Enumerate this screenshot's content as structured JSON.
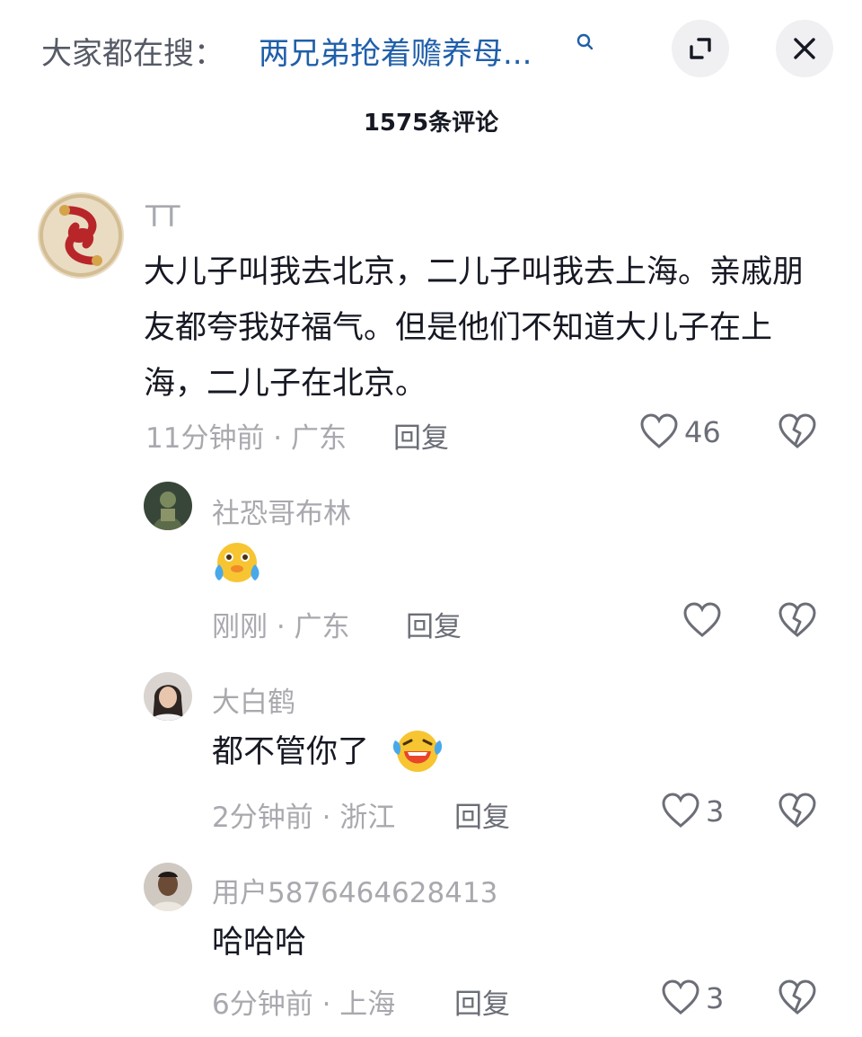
{
  "header": {
    "search_prefix": "大家都在搜：",
    "search_query": "两兄弟抢着赡养母...",
    "search_icon": "search-icon",
    "expand_icon": "expand-icon",
    "close_icon": "close-icon"
  },
  "comment_count": "1575条评论",
  "comments": [
    {
      "username": "TT",
      "text": "大儿子叫我去北京，二儿子叫我去上海。亲戚朋友都夸我好福气。但是他们不知道大儿子在上海，二儿子在北京。",
      "time": "11分钟前 · 广东",
      "reply_label": "回复",
      "likes": "46",
      "avatar_icon": "pisces-avatar"
    },
    {
      "username": "社恐哥布林",
      "text": "",
      "emoji": "crying-laughing-emoji",
      "time": "刚刚 · 广东",
      "reply_label": "回复",
      "likes": "",
      "avatar_icon": "goblin-avatar"
    },
    {
      "username": "大白鹤",
      "text": "都不管你了",
      "emoji": "laughing-emoji",
      "time": "2分钟前 · 浙江",
      "reply_label": "回复",
      "likes": "3",
      "avatar_icon": "person-avatar"
    },
    {
      "username": "用户5876464628413",
      "text": "哈哈哈",
      "time": "6分钟前 · 上海",
      "reply_label": "回复",
      "likes": "3",
      "avatar_icon": "person-avatar"
    }
  ],
  "colors": {
    "accent_link": "#1f5faa",
    "muted_text": "#a8a9ae",
    "main_text": "#161823"
  }
}
